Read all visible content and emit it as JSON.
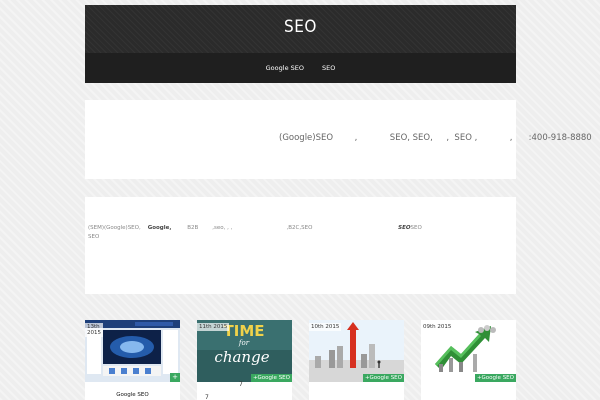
{
  "site": {
    "title": "SEO"
  },
  "nav": {
    "items": [
      "Google SEO",
      "SEO"
    ]
  },
  "panel1": {
    "text": "(Google)SEO        ,            SEO, SEO,     ,  SEO ,            ,      :400-918-8880"
  },
  "panel2": {
    "line1a": "(SEM)(Google)SEO,",
    "line1b": "Google,",
    "line1c": "B2B        ,seo, , ,                               ,B2C,SEO",
    "line1d": "SEO",
    "line1e": "SEO",
    "line2": "SEO"
  },
  "cards": [
    {
      "date": "13th\n2015",
      "thumb": "browser-screenshot",
      "title": "Google SEO",
      "action": "+"
    },
    {
      "date": "11th 2015",
      "thumb": "time-for-change",
      "tag": "+Google SEO",
      "num1": "7",
      "num2": "7"
    },
    {
      "date": "10th 2015",
      "thumb": "red-arrow-growth",
      "tag": "+Google SEO"
    },
    {
      "date": "09th 2015",
      "thumb": "green-arrow-chart",
      "tag": "+Google SEO"
    }
  ],
  "colors": {
    "header_bg": "#2b2b2b",
    "nav_bg": "#1f1f1f",
    "tag_green": "#3aa860"
  }
}
